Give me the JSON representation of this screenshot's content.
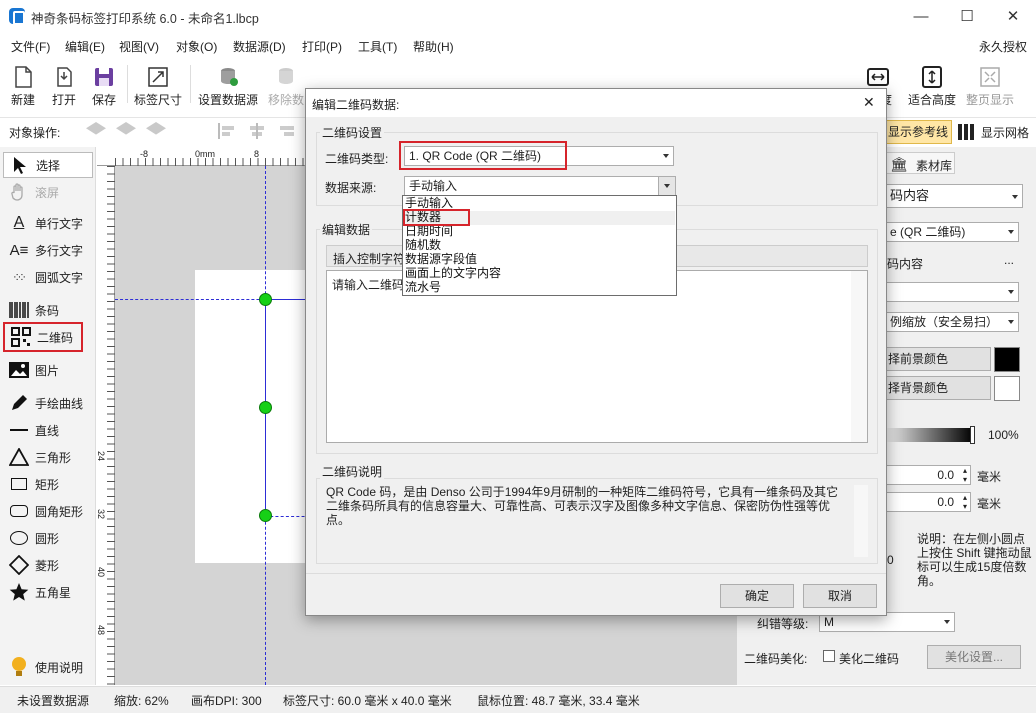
{
  "window": {
    "title": "神奇条码标签打印系统 6.0 - 未命名1.lbcp",
    "minimize": "—",
    "maximize": "☐",
    "close": "✕"
  },
  "menu": [
    "文件(F)",
    "编辑(E)",
    "视图(V)",
    "对象(O)",
    "数据源(D)",
    "打印(P)",
    "工具(T)",
    "帮助(H)"
  ],
  "menu_right": "永久授权",
  "toolbar": {
    "new": "新建",
    "open": "打开",
    "save": "保存",
    "label_size": "标签尺寸",
    "set_datasource": "设置数据源",
    "remove_data": "移除数",
    "fit_width_partial": "度",
    "fit_height": "适合高度",
    "full_page": "整页显示"
  },
  "objbar": {
    "label": "对象操作:",
    "show_guides": "显示参考线",
    "show_grid": "显示网格"
  },
  "tools": [
    {
      "label": "选择",
      "icon": "cursor-icon"
    },
    {
      "label": "滚屏",
      "icon": "hand-icon"
    },
    {
      "label": "单行文字",
      "icon": "single-text-icon"
    },
    {
      "label": "多行文字",
      "icon": "multi-text-icon"
    },
    {
      "label": "圆弧文字",
      "icon": "arc-text-icon"
    },
    {
      "label": "条码",
      "icon": "barcode-icon"
    },
    {
      "label": "二维码",
      "icon": "qrcode-icon"
    },
    {
      "label": "图片",
      "icon": "image-icon"
    },
    {
      "label": "手绘曲线",
      "icon": "pen-icon"
    },
    {
      "label": "直线",
      "icon": "line-icon"
    },
    {
      "label": "三角形",
      "icon": "triangle-icon"
    },
    {
      "label": "矩形",
      "icon": "rectangle-icon"
    },
    {
      "label": "圆角矩形",
      "icon": "rounded-rect-icon"
    },
    {
      "label": "圆形",
      "icon": "circle-icon"
    },
    {
      "label": "菱形",
      "icon": "diamond-icon"
    },
    {
      "label": "五角星",
      "icon": "star-icon"
    },
    {
      "label": "使用说明",
      "icon": "bulb-icon"
    }
  ],
  "ruler": {
    "top": [
      "-8",
      "0mm",
      "8"
    ],
    "left": [
      "24",
      "32",
      "40",
      "48"
    ]
  },
  "right_panel": {
    "tab_material": "素材库",
    "content_combo": "码内容",
    "type_combo": "e (QR 二维码)",
    "content_label": "码内容",
    "content_more": "...",
    "scale_combo": "例缩放（安全易扫）",
    "fg_color_btn": "择前景颜色",
    "bg_color_btn": "择背景颜色",
    "fg_color": "#000000",
    "bg_color": "#ffffff",
    "opacity": "100%",
    "x_value": "0.0",
    "y_value": "0.0",
    "unit": "毫米",
    "partial_num": "0",
    "hint": "说明：在左侧小圆点上按住 Shift 键拖动鼠标可以生成15度倍数角。",
    "ecc_label": "纠错等级:",
    "ecc_value": "M",
    "beautify_label": "二维码美化:",
    "beautify_check": "美化二维码",
    "beautify_btn": "美化设置..."
  },
  "status": {
    "datasource": "未设置数据源",
    "zoom": "缩放: 62%",
    "dpi": "画布DPI: 300",
    "size": "标签尺寸: 60.0 毫米 x 40.0 毫米",
    "mouse": "鼠标位置: 48.7 毫米, 33.4 毫米"
  },
  "dialog": {
    "title": "编辑二维码数据:",
    "close": "✕",
    "group_settings": "二维码设置",
    "type_label": "二维码类型:",
    "type_value": "1. QR Code (QR 二维码)",
    "source_label": "数据来源:",
    "source_value": "手动输入",
    "source_options": [
      "手动输入",
      "计数器",
      "日期时间",
      "随机数",
      "数据源字段值",
      "画面上的文字内容",
      "流水号"
    ],
    "group_edit": "编辑数据",
    "insert_ctrl": "插入控制字符",
    "input_text": "请输入二维码",
    "group_desc": "二维码说明",
    "description": "QR Code 码，是由 Denso 公司于1994年9月研制的一种矩阵二维码符号，它具有一维条码及其它二维条码所具有的信息容量大、可靠性高、可表示汉字及图像多种文字信息、保密防伪性强等优点。",
    "ok": "确定",
    "cancel": "取消"
  },
  "colors": {
    "highlight_red": "#d6242b",
    "guide_blue": "#2d2dd6",
    "handle_green": "#16d016"
  }
}
